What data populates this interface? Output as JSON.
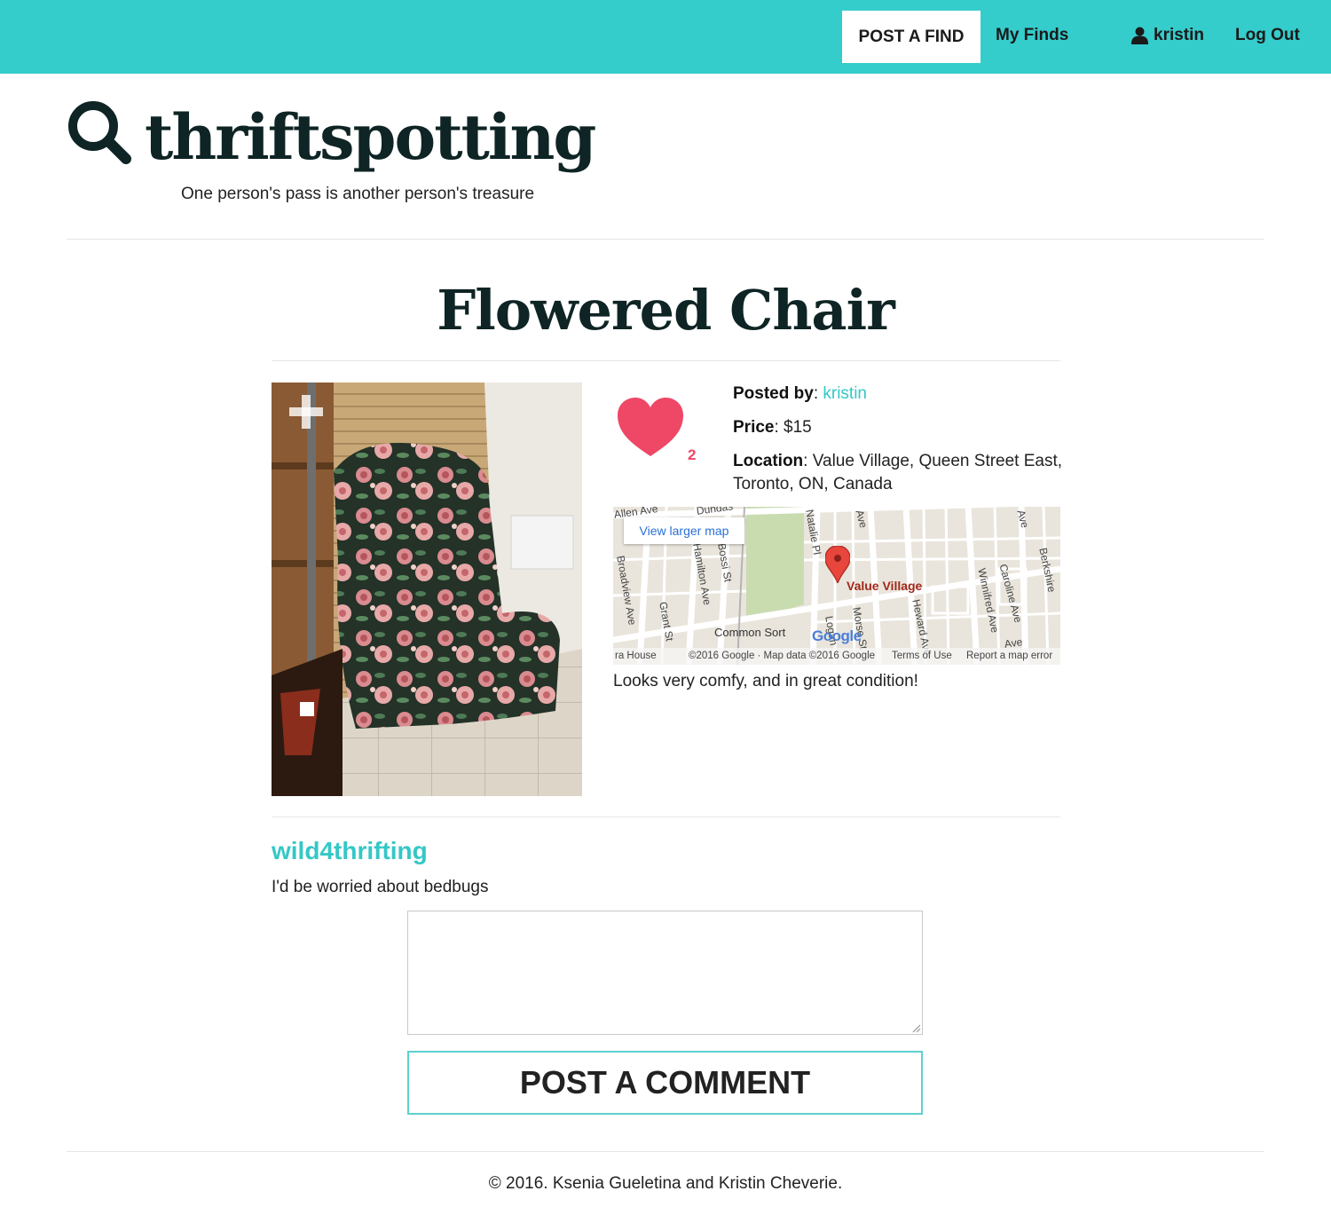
{
  "nav": {
    "post_find": "POST A FIND",
    "my_finds": "My Finds",
    "username": "kristin",
    "user_icon": "user-icon",
    "logout": "Log Out"
  },
  "brand": {
    "icon": "search-icon",
    "name": "thriftspotting",
    "tagline": "One person's pass is another person's treasure"
  },
  "find": {
    "title": "Flowered Chair",
    "likes": "2",
    "posted_by_label": "Posted by",
    "posted_by": "kristin",
    "price_label": "Price",
    "price": "$15",
    "location_label": "Location",
    "location_line1": "Value Village, Queen Street East,",
    "location_line2": "Toronto, ON, Canada",
    "description": "Looks very comfy, and in great condition!"
  },
  "map": {
    "view_larger": "View larger map",
    "place": "Value Village",
    "nearby": "Common Sort",
    "logo": "Google",
    "footer_left": "ra House",
    "copyright": "©2016 Google · Map data ©2016 Google",
    "terms": "Terms of Use",
    "report": "Report a map error",
    "streets": [
      "Natalie Pl",
      "Ave",
      "Ave",
      "Grant St",
      "Heward Ave",
      "Winnifred Ave",
      "Caroline Ave",
      "Berkshire",
      "Morse St",
      "Logan",
      "Broadview Ave",
      "Hamilton Ave",
      "Bossi St",
      "Dundas",
      "Allen Ave",
      "Ave"
    ]
  },
  "comments": [
    {
      "author": "wild4thrifting",
      "text": "I'd be worried about bedbugs"
    }
  ],
  "comment_form": {
    "placeholder": "",
    "submit": "POST A COMMENT"
  },
  "footer": {
    "text": "© 2016. Ksenia Gueletina and Kristin Cheverie."
  },
  "colors": {
    "brand": "#35cccc",
    "link": "#35c7c7",
    "heart": "#ef4766",
    "title": "#0f2424"
  }
}
